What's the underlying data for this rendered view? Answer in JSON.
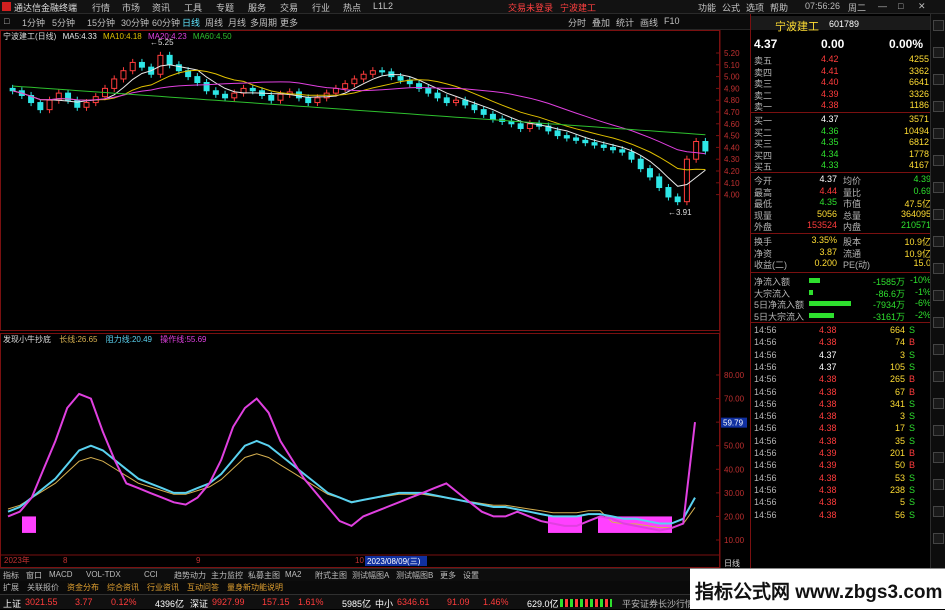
{
  "menubar": {
    "app_title": "通达信金融终端",
    "menus": [
      "行情",
      "市场",
      "资讯",
      "工具",
      "专题",
      "服务",
      "交易",
      "行业",
      "热点",
      "L1L2"
    ],
    "trade_login": "交易未登录",
    "stock_tag": "宁波建工",
    "right_menus": [
      "功能",
      "公式",
      "选项",
      "帮助"
    ],
    "clock": "07:56:26",
    "weekday": "周二"
  },
  "toolbar": {
    "items": [
      "□",
      "1分钟",
      "5分钟",
      "15分钟",
      "30分钟",
      "60分钟",
      "日线",
      "周线",
      "月线",
      "多周期",
      "更多"
    ],
    "active": "日线",
    "right_items": [
      "分时",
      "叠加",
      "统计",
      "画线",
      "F10"
    ]
  },
  "main_chart": {
    "title": "宁波建工(日线)",
    "ma": [
      {
        "label": "MA5:",
        "value": "4.33",
        "color": "#e8e8e8"
      },
      {
        "label": "MA10:",
        "value": "4.18",
        "color": "#e0c000"
      },
      {
        "label": "MA20:",
        "value": "4.23",
        "color": "#e040e0"
      },
      {
        "label": "MA60:",
        "value": "4.50",
        "color": "#2ec02e"
      }
    ],
    "high_label": "5.25",
    "low_label": "3.91",
    "y_ticks": [
      "5.20",
      "5.10",
      "5.00",
      "4.90",
      "4.80",
      "4.70",
      "4.60",
      "4.50",
      "4.40",
      "4.30",
      "4.20",
      "4.10",
      "4.00"
    ],
    "badge": "日线"
  },
  "indicator": {
    "title": "发现小牛抄底",
    "lines": [
      {
        "label": "长线:",
        "value": "26.65",
        "color": "#d6b050"
      },
      {
        "label": "阻力线:",
        "value": "20.49",
        "color": "#5ad2f0"
      },
      {
        "label": "操作线:",
        "value": "55.69",
        "color": "#e040e0"
      }
    ],
    "y_ticks": [
      "80.00",
      "70.00",
      "60.00",
      "50.00",
      "40.00",
      "30.00",
      "20.00",
      "10.00"
    ],
    "current_tag": "59.79",
    "date_tag": "2023/08/09(三)",
    "year_label": "2023年"
  },
  "quote": {
    "name": "宁波建工",
    "code": "601789",
    "price": "4.37",
    "change": "0.00",
    "change_pct": "0.00%",
    "asks": [
      {
        "label": "卖五",
        "price": "4.42",
        "vol": "4255"
      },
      {
        "label": "卖四",
        "price": "4.41",
        "vol": "3362"
      },
      {
        "label": "卖三",
        "price": "4.40",
        "vol": "6641"
      },
      {
        "label": "卖二",
        "price": "4.39",
        "vol": "3326"
      },
      {
        "label": "卖一",
        "price": "4.38",
        "vol": "1186"
      }
    ],
    "bids": [
      {
        "label": "买一",
        "price": "4.37",
        "vol": "3571"
      },
      {
        "label": "买二",
        "price": "4.36",
        "vol": "10494"
      },
      {
        "label": "买三",
        "price": "4.35",
        "vol": "6812"
      },
      {
        "label": "买四",
        "price": "4.34",
        "vol": "1778"
      },
      {
        "label": "买五",
        "price": "4.33",
        "vol": "4167"
      }
    ],
    "stats": [
      {
        "l1": "今开",
        "v1": "4.37",
        "l2": "均价",
        "v2": "4.39"
      },
      {
        "l1": "最高",
        "v1": "4.44",
        "l2": "量比",
        "v2": "0.69"
      },
      {
        "l1": "最低",
        "v1": "4.35",
        "l2": "市值",
        "v2": "47.5亿"
      },
      {
        "l1": "现量",
        "v1": "5056",
        "l2": "总量",
        "v2": "364095"
      },
      {
        "l1": "外盘",
        "v1": "153524",
        "l2": "内盘",
        "v2": "210571"
      }
    ],
    "stats2": [
      {
        "l1": "换手",
        "v1": "3.35%",
        "l2": "股本",
        "v2": "10.9亿"
      },
      {
        "l1": "净资",
        "v1": "3.87",
        "l2": "流通",
        "v2": "10.9亿"
      },
      {
        "l1": "收益(二)",
        "v1": "0.200",
        "l2": "PE(动)",
        "v2": "15.0"
      }
    ],
    "flows": [
      {
        "label": "净流入额",
        "value": "-1585万",
        "pct": "-10%",
        "bar": 0.15
      },
      {
        "label": "大宗流入",
        "value": "-86.6万",
        "pct": "-1%",
        "bar": 0.05
      },
      {
        "label": "5日净流入额",
        "value": "-7934万",
        "pct": "-6%",
        "bar": 0.6
      },
      {
        "label": "5日大宗流入",
        "value": "-3161万",
        "pct": "-2%",
        "bar": 0.35
      }
    ],
    "ticks": [
      {
        "time": "14:56",
        "price": "4.38",
        "vol": "664",
        "bs": "S"
      },
      {
        "time": "14:56",
        "price": "4.38",
        "vol": "74",
        "bs": "B"
      },
      {
        "time": "14:56",
        "price": "4.37",
        "vol": "3",
        "bs": "S"
      },
      {
        "time": "14:56",
        "price": "4.37",
        "vol": "105",
        "bs": "S"
      },
      {
        "time": "14:56",
        "price": "4.38",
        "vol": "265",
        "bs": "B"
      },
      {
        "time": "14:56",
        "price": "4.38",
        "vol": "67",
        "bs": "B"
      },
      {
        "time": "14:56",
        "price": "4.38",
        "vol": "341",
        "bs": "S"
      },
      {
        "time": "14:56",
        "price": "4.38",
        "vol": "3",
        "bs": "S"
      },
      {
        "time": "14:56",
        "price": "4.38",
        "vol": "17",
        "bs": "S"
      },
      {
        "time": "14:56",
        "price": "4.38",
        "vol": "35",
        "bs": "S"
      },
      {
        "time": "14:56",
        "price": "4.39",
        "vol": "201",
        "bs": "B"
      },
      {
        "time": "14:56",
        "price": "4.39",
        "vol": "50",
        "bs": "B"
      },
      {
        "time": "14:56",
        "price": "4.38",
        "vol": "53",
        "bs": "S"
      },
      {
        "time": "14:56",
        "price": "4.38",
        "vol": "238",
        "bs": "S"
      },
      {
        "time": "14:56",
        "price": "4.38",
        "vol": "5",
        "bs": "S"
      },
      {
        "time": "14:56",
        "price": "4.38",
        "vol": "56",
        "bs": "S"
      }
    ]
  },
  "bottom_tabs": [
    "指标",
    "窗口",
    "MACD",
    "VOL-TDX",
    "CCI",
    "趋势动力",
    "主力监控",
    "私募主图",
    "MA2",
    "附式主图",
    "测试幅图A",
    "测试幅图B",
    "更多",
    "设置"
  ],
  "sub_tabs": [
    "扩展",
    "关联报价",
    "资金分布",
    "综合资讯",
    "行业资讯",
    "互动问答",
    "量身新功能说明"
  ],
  "status": [
    {
      "name": "上证",
      "value": "3021.55",
      "chg": "3.77",
      "pct": "0.12%",
      "amt": "4396亿"
    },
    {
      "name": "深证",
      "value": "9927.99",
      "chg": "157.15",
      "pct": "1.61%",
      "amt": "5985亿"
    },
    {
      "name": "中小",
      "value": "6346.61",
      "chg": "91.09",
      "pct": "1.46%",
      "amt": "629.0亿"
    }
  ],
  "status_right": "平安证券长沙行情",
  "watermark": "指标公式网 www.zbgs3.com",
  "colors": {
    "up": "#ff3c3c",
    "down": "#2ee6e6",
    "ma5": "#e8e8e8",
    "ma10": "#e0c000",
    "ma20": "#e040e0",
    "ma60": "#2ec02e",
    "operation": "#e040e0",
    "resistance": "#5ad2f0",
    "longline": "#d6b050"
  }
}
